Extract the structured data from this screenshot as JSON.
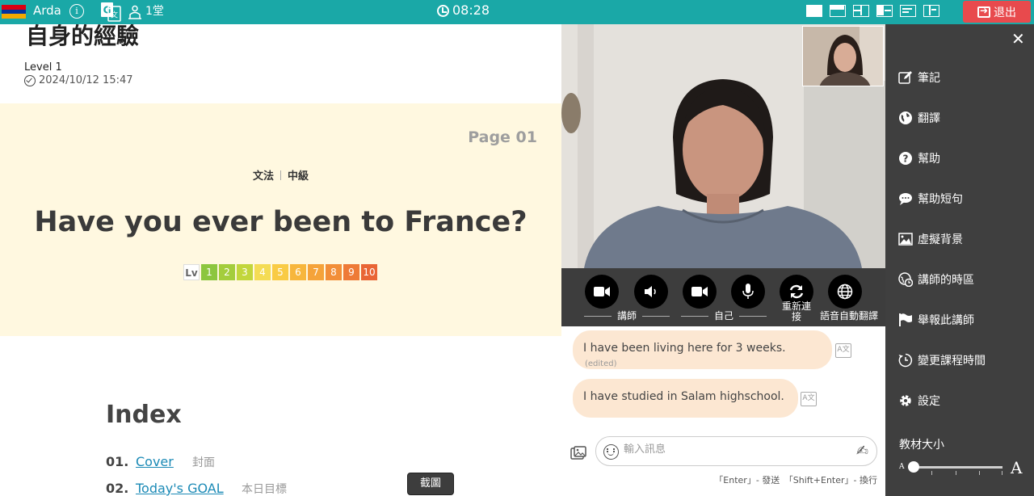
{
  "topbar": {
    "user_name": "Arda",
    "info_icon": "info-icon",
    "room_label": "1堂",
    "clock": "08:28",
    "exit_label": "退出",
    "flag_colors": [
      "#d90012",
      "#0033a0",
      "#f2a800"
    ]
  },
  "material": {
    "title": "自身的經驗",
    "level": "Level 1",
    "date": "2024/10/12 15:47",
    "page": "Page 01",
    "tag_grammar": "文法",
    "tag_level": "中級",
    "headline": "Have you ever been to France?",
    "lv_tag": "Lv",
    "levels": [
      "1",
      "2",
      "3",
      "4",
      "5",
      "6",
      "7",
      "8",
      "9",
      "10"
    ],
    "level_colors": [
      "#8cc63f",
      "#a4cd3c",
      "#c2d63c",
      "#f4dc54",
      "#f9cb45",
      "#f7b63c",
      "#f5a33a",
      "#f28e38",
      "#ee7a37",
      "#e96535"
    ],
    "index_title": "Index",
    "index_items": [
      {
        "num": "01.",
        "link": "Cover",
        "zh": "封面"
      },
      {
        "num": "02.",
        "link": "Today's GOAL",
        "zh": "本日目標"
      }
    ],
    "screenshot_label": "截圖"
  },
  "video_controls": {
    "teacher_label": "講師",
    "self_label": "自己",
    "reconnect_label": "重新連接",
    "auto_translate_label": "語音自動翻譯"
  },
  "chat": {
    "messages": [
      {
        "text": "I have been living here for 3 weeks.",
        "edited": "(edited)"
      },
      {
        "text": "I have studied in Salam highschool.",
        "edited": ""
      }
    ],
    "input_placeholder": "輸入訊息",
    "hint": "「Enter」- 發送　「Shift+Enter」- 換行"
  },
  "sidebar": {
    "items": [
      {
        "label": "筆記",
        "icon": "edit-icon"
      },
      {
        "label": "翻譯",
        "icon": "globe-icon"
      },
      {
        "label": "幫助",
        "icon": "help-icon"
      },
      {
        "label": "幫助短句",
        "icon": "chat-bubble-icon"
      },
      {
        "label": "虛擬背景",
        "icon": "image-icon"
      },
      {
        "label": "講師的時區",
        "icon": "world-clock-icon"
      },
      {
        "label": "舉報此講師",
        "icon": "flag-icon"
      },
      {
        "label": "變更課程時間",
        "icon": "reschedule-icon"
      },
      {
        "label": "設定",
        "icon": "gear-icon"
      }
    ],
    "font_size_label": "教材大小",
    "font_small_glyph": "A",
    "font_big_glyph": "A",
    "font_size_level": 0
  },
  "colors": {
    "topbar": "#1aa8a7",
    "exit": "#e84a4d",
    "sidebar": "#3f3f3f",
    "cover": "#fff8e0",
    "bubble": "#fce7d2",
    "link": "#1b8ab6"
  }
}
